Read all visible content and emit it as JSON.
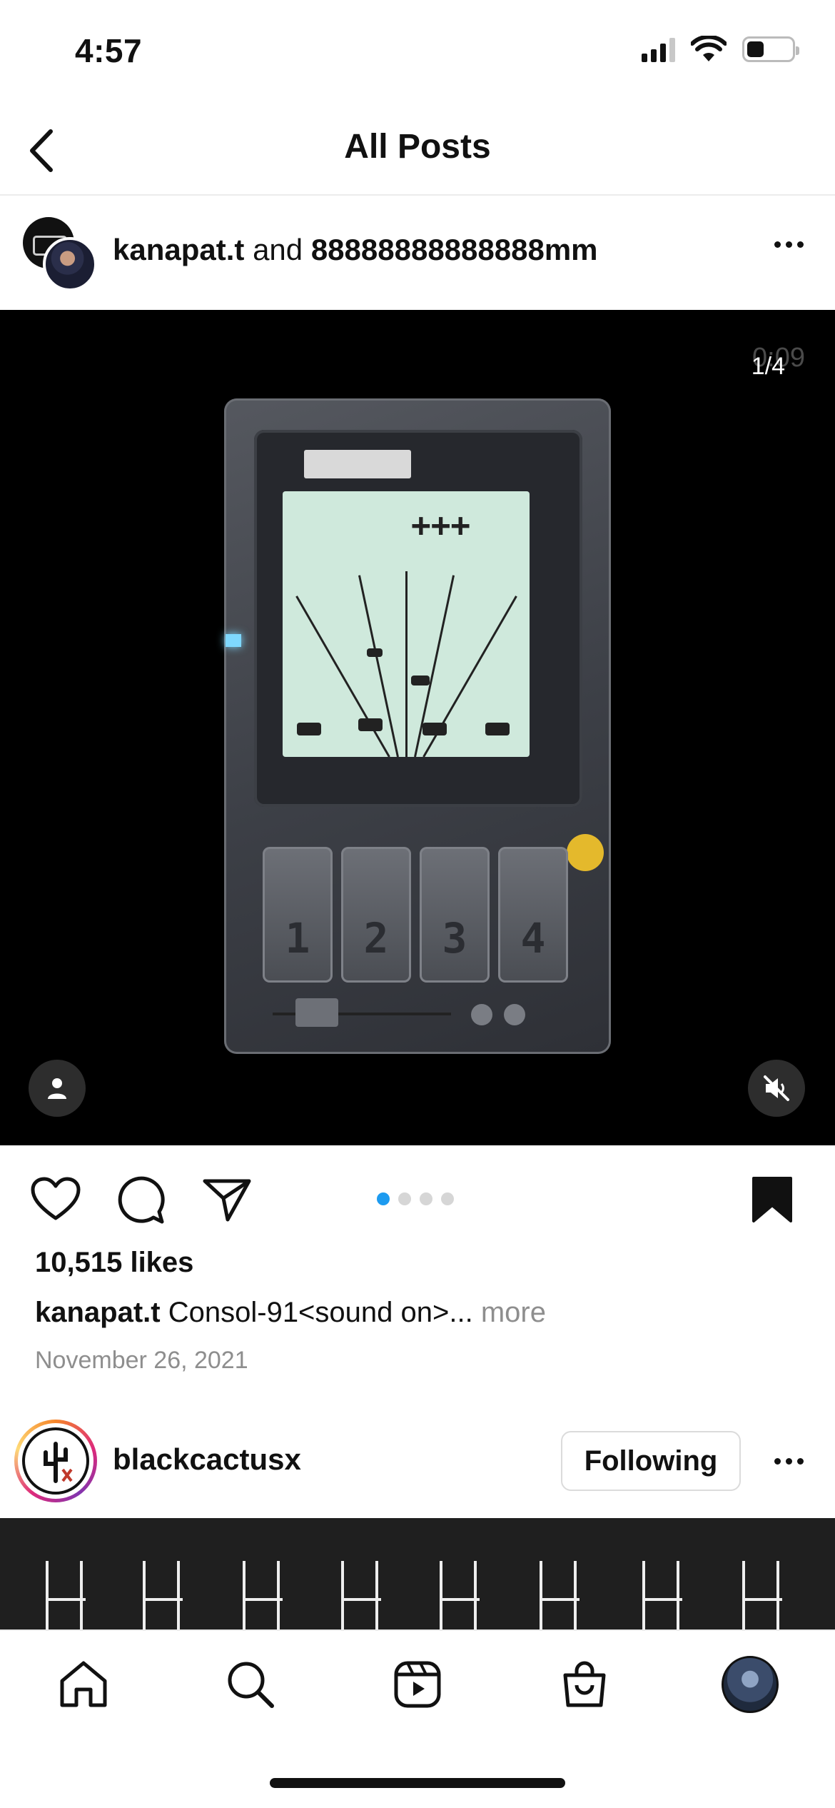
{
  "status_bar": {
    "time": "4:57"
  },
  "nav": {
    "title": "All Posts"
  },
  "post": {
    "user1": "kanapat.t",
    "conjunction": "and",
    "user2": "88888888888888mm",
    "video_time": "0:09",
    "counter": "1/4",
    "device_keys": [
      "1",
      "2",
      "3",
      "4"
    ],
    "screen_plus": "+++",
    "pager": {
      "total": 4,
      "active": 1
    },
    "likes": "10,515 likes",
    "caption_user": "kanapat.t",
    "caption_text": "Consol-91<sound on>...",
    "caption_more": "more",
    "date": "November 26, 2021"
  },
  "next_post": {
    "username": "blackcactusx",
    "follow_label": "Following"
  },
  "icons": {
    "back": "chevron-left-icon",
    "more": "more-horizontal-icon",
    "tag": "person-tag-icon",
    "mute": "speaker-muted-icon",
    "like": "heart-icon",
    "comment": "comment-icon",
    "share": "paper-plane-icon",
    "save": "bookmark-filled-icon",
    "tabs": [
      "home-icon",
      "search-icon",
      "reels-icon",
      "shop-icon",
      "profile-avatar"
    ]
  },
  "colors": {
    "accent": "#1d9bf0",
    "muted_text": "#8e8e8e",
    "media_bg": "#000000"
  }
}
